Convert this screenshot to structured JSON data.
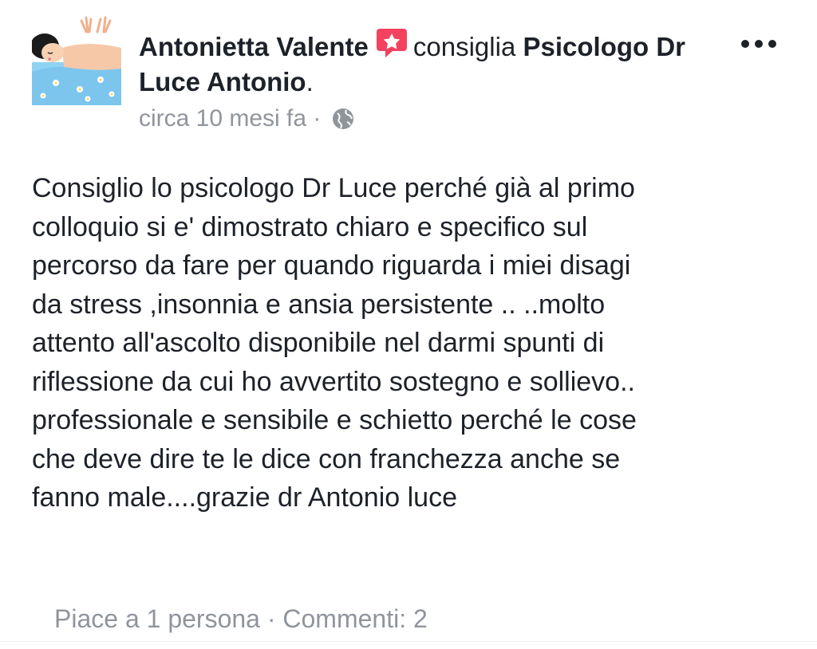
{
  "post": {
    "author": "Antonietta Valente",
    "action": "consiglia",
    "page_name": "Psicologo Dr Luce Antonio",
    "period": ".",
    "timestamp": "circa 10 mesi fa",
    "separator": "·",
    "body": "Consiglio lo psicologo Dr Luce perché già al primo\ncolloquio si e' dimostrato chiaro e specifico sul\npercorso da fare per quando riguarda i miei disagi\nda stress ,insonnia e ansia persistente .. ..molto\nattento all'ascolto disponibile nel darmi spunti di\nriflessione da cui ho avvertito sostegno e sollievo..\nprofessionale e sensibile e schietto perché le cose\nche deve dire te le dice con franchezza anche se\nfanno male....grazie dr Antonio luce",
    "likes": "Piace a 1 persona",
    "footer_separator": " · ",
    "comments": "Commenti: 2"
  },
  "icons": {
    "avatar": "spa-massage-avatar",
    "recommend": "recommend-star-icon",
    "audience": "globe-icon",
    "more": "more-options-icon"
  },
  "colors": {
    "text": "#1d2129",
    "secondary": "#90949c",
    "recommend_badge": "#f3425f"
  }
}
